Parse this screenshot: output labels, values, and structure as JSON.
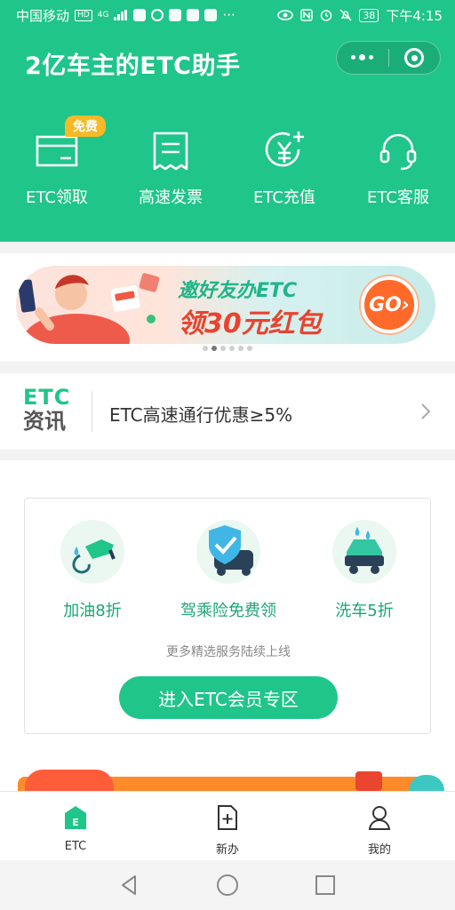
{
  "status_bar": {
    "carrier": "中国移动",
    "hd": "HD",
    "net": "4G",
    "battery": "38",
    "time": "下午4:15"
  },
  "header": {
    "title": "2亿车主的ETC助手",
    "quick_actions": [
      {
        "label": "ETC领取",
        "icon": "etc-card-icon",
        "badge": "免费"
      },
      {
        "label": "高速发票",
        "icon": "invoice-icon"
      },
      {
        "label": "ETC充值",
        "icon": "recharge-icon"
      },
      {
        "label": "ETC客服",
        "icon": "headset-icon"
      }
    ]
  },
  "banner": {
    "line1": "邀好友办ETC",
    "line2": "领30元红包",
    "go": "GO›",
    "page_count": 6,
    "active_page": 1
  },
  "news": {
    "logo_top": "ETC",
    "logo_bottom": "资讯",
    "text": "ETC高速通行优惠≥5%"
  },
  "member": {
    "services": [
      {
        "label": "加油8折",
        "icon": "fuel-nozzle-icon"
      },
      {
        "label": "驾乘险免费领",
        "icon": "insurance-shield-icon"
      },
      {
        "label": "洗车5折",
        "icon": "car-wash-icon"
      }
    ],
    "more_text": "更多精选服务陆续上线",
    "button": "进入ETC会员专区"
  },
  "tabbar": {
    "tabs": [
      {
        "label": "ETC",
        "icon": "etc-home-icon",
        "active": true
      },
      {
        "label": "新办",
        "icon": "new-apply-icon",
        "active": false
      },
      {
        "label": "我的",
        "icon": "profile-icon",
        "active": false
      }
    ]
  },
  "colors": {
    "brand": "#1fc589",
    "accent_orange": "#f7b928",
    "red": "#e8432e"
  }
}
